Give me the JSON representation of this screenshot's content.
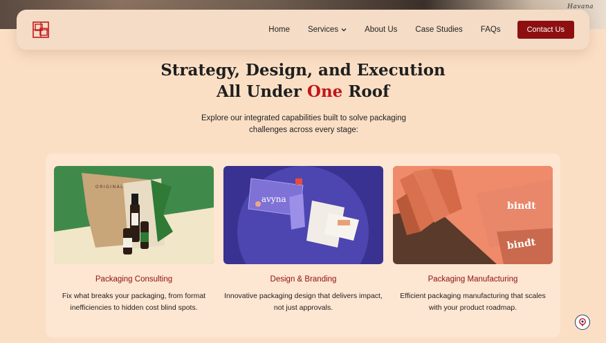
{
  "top_strip": {
    "overlay_text": "Havana"
  },
  "nav": {
    "logo_name": "box-logo",
    "links": [
      "Home",
      "Services",
      "About Us",
      "Case Studies",
      "FAQs"
    ],
    "contact_label": "Contact Us"
  },
  "hero": {
    "line1": "Strategy, Design, and Execution",
    "line2_pre": "All Under ",
    "line2_accent": "One",
    "line2_post": " Roof",
    "subtitle": "Explore our integrated capabilities built to solve packaging challenges across every stage:"
  },
  "cards": [
    {
      "title": "Packaging Consulting",
      "description": "Fix what breaks your packaging, from format inefficiencies to hidden cost blind spots.",
      "image_text": "ORIGINAL"
    },
    {
      "title": "Design & Branding",
      "description": "Innovative packaging design that delivers impact, not just approvals.",
      "image_text": "avyna"
    },
    {
      "title": "Packaging Manufacturing",
      "description": "Efficient packaging manufacturing that scales with your product roadmap.",
      "image_text": "bindt"
    }
  ],
  "colors": {
    "brand": "#8e0f10",
    "accent": "#c2161b",
    "background": "#fbdfc5"
  },
  "chat_icon": "chat-support-icon"
}
